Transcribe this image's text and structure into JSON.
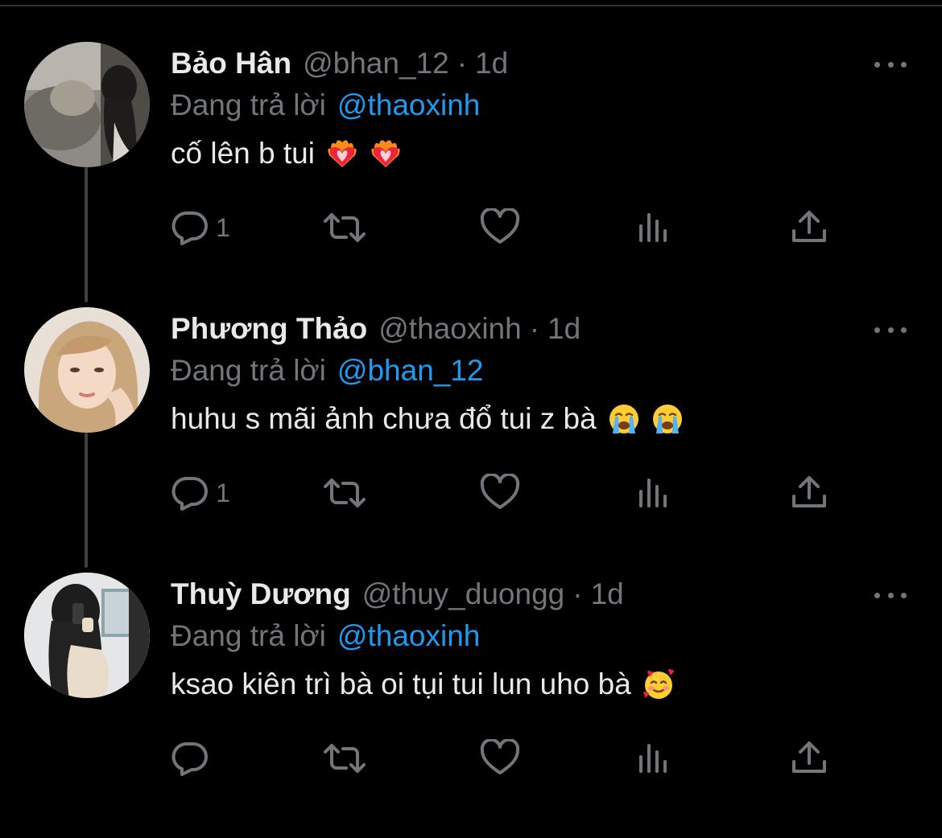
{
  "thread": [
    {
      "display_name": "Bảo Hân",
      "handle": "@bhan_12",
      "separator": "·",
      "time": "1d",
      "reply_prefix": "Đang trả lời",
      "reply_to": "@thaoxinh",
      "text": "cố lên b tui",
      "emojis": [
        "heart-on-fire",
        "heart-on-fire"
      ],
      "reply_count": "1"
    },
    {
      "display_name": "Phương Thảo",
      "handle": "@thaoxinh",
      "separator": "·",
      "time": "1d",
      "reply_prefix": "Đang trả lời",
      "reply_to": "@bhan_12",
      "text": "huhu s mãi ảnh chưa đổ tui z bà",
      "emojis": [
        "loudly-crying-face",
        "loudly-crying-face"
      ],
      "reply_count": "1"
    },
    {
      "display_name": "Thuỳ Dương",
      "handle": "@thuy_duongg",
      "separator": "·",
      "time": "1d",
      "reply_prefix": "Đang trả lời",
      "reply_to": "@thaoxinh",
      "text": "ksao kiên trì bà oi tụi tui lun uho bà",
      "emojis": [
        "smiling-face-with-hearts"
      ],
      "reply_count": ""
    }
  ],
  "icons": {
    "reply": "reply-icon",
    "retweet": "retweet-icon",
    "like": "heart-icon",
    "analytics": "analytics-icon",
    "share": "share-icon",
    "more": "more-icon"
  },
  "colors": {
    "background": "#000000",
    "primary_text": "#e7e9ea",
    "secondary_text": "#71767b",
    "link": "#1d9bf0",
    "thread_line": "#3e4144"
  }
}
